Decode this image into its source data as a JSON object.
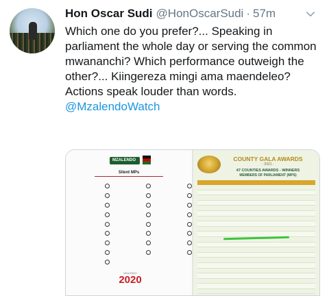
{
  "author": {
    "name": "Hon Oscar Sudi",
    "handle": "@HonOscarSudi",
    "separator": "·",
    "time": "57m"
  },
  "tweet": {
    "line1": "Which one do you prefer?... Speaking in parliament the whole day or serving the common mwananchi?  Which performance outweigh the other?... Kiingereza mingi ama maendeleo?",
    "line2": "Actions speak louder than words.",
    "mention": "@MzalendoWatch"
  },
  "icons": {
    "menu": "chevron-down-icon",
    "avatar": "profile-photo"
  },
  "media": {
    "left_image": {
      "logo_text": "MZALENDO",
      "title": "Silent MPs",
      "footer_small": "MZALENDO",
      "footer_year": "2020"
    },
    "right_image": {
      "title": "COUNTY GALA AWARDS",
      "year": "- 2021 -",
      "banner": "47 COUNTIES AWARDS - WINNERS",
      "subtitle": "MEMBERS OF PARLIAMENT (MPS)"
    }
  },
  "colors": {
    "mention": "#1b95e0",
    "secondary_text": "#657786",
    "primary_text": "#14171a",
    "border": "#ccd6dd"
  }
}
